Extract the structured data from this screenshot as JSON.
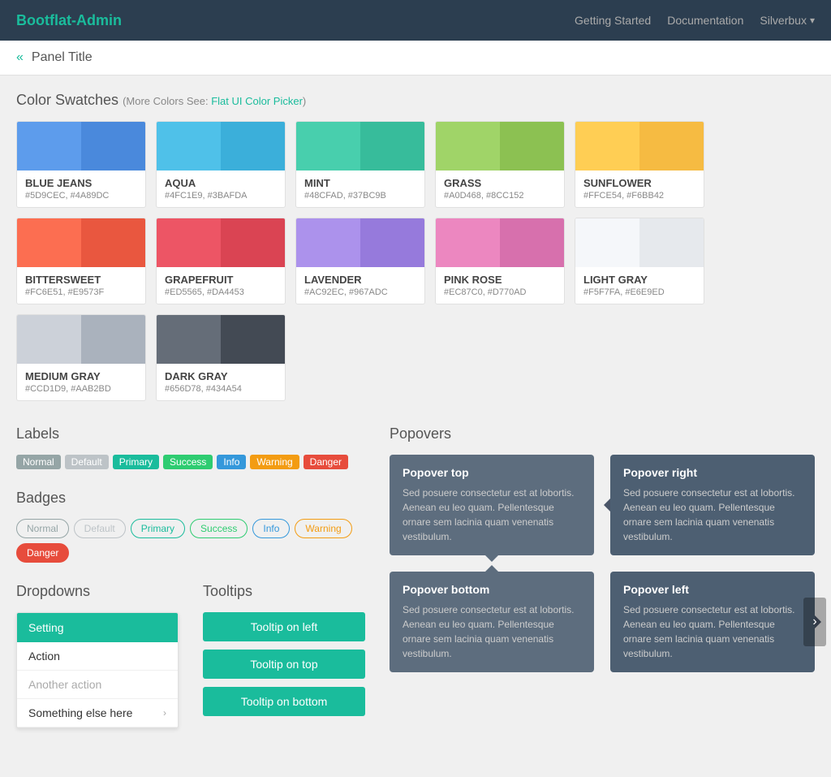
{
  "navbar": {
    "brand": "Bootflat-Admin",
    "links": [
      "Getting Started",
      "Documentation"
    ],
    "dropdown": "Silverbux"
  },
  "panel": {
    "title": "Panel Title"
  },
  "color_swatches": {
    "section_title": "Color Swatches",
    "more_colors_label": "More Colors See",
    "more_colors_link": "Flat UI Color Picker",
    "colors": [
      {
        "name": "BLUE JEANS",
        "hex": "#5D9CEC, #4A89DC",
        "c1": "#5D9CEC",
        "c2": "#4A89DC"
      },
      {
        "name": "AQUA",
        "hex": "#4FC1E9, #3BAFDA",
        "c1": "#4FC1E9",
        "c2": "#3BAFDA"
      },
      {
        "name": "MINT",
        "hex": "#48CFAD, #37BC9B",
        "c1": "#48CFAD",
        "c2": "#37BC9B"
      },
      {
        "name": "GRASS",
        "hex": "#A0D468, #8CC152",
        "c1": "#A0D468",
        "c2": "#8CC152"
      },
      {
        "name": "SUNFLOWER",
        "hex": "#FFCE54, #F6BB42",
        "c1": "#FFCE54",
        "c2": "#F6BB42"
      },
      {
        "name": "BITTERSWEET",
        "hex": "#FC6E51, #E9573F",
        "c1": "#FC6E51",
        "c2": "#E9573F"
      },
      {
        "name": "GRAPEFRUIT",
        "hex": "#ED5565, #DA4453",
        "c1": "#ED5565",
        "c2": "#DA4453"
      },
      {
        "name": "LAVENDER",
        "hex": "#AC92EC, #967ADC",
        "c1": "#AC92EC",
        "c2": "#967ADC"
      },
      {
        "name": "PINK ROSE",
        "hex": "#EC87C0, #D770AD",
        "c1": "#EC87C0",
        "c2": "#D770AD"
      },
      {
        "name": "LIGHT GRAY",
        "hex": "#F5F7FA, #E6E9ED",
        "c1": "#F5F7FA",
        "c2": "#E6E9ED"
      },
      {
        "name": "MEDIUM GRAY",
        "hex": "#CCD1D9, #AAB2BD",
        "c1": "#CCD1D9",
        "c2": "#AAB2BD"
      },
      {
        "name": "DARK GRAY",
        "hex": "#656D78, #434A54",
        "c1": "#656D78",
        "c2": "#434A54"
      }
    ]
  },
  "labels": {
    "section_title": "Labels",
    "items": [
      "Normal",
      "Default",
      "Primary",
      "Success",
      "Info",
      "Warning",
      "Danger"
    ]
  },
  "badges": {
    "section_title": "Badges",
    "items": [
      "Normal",
      "Default",
      "Primary",
      "Success",
      "Info",
      "Warning",
      "Danger"
    ]
  },
  "dropdowns": {
    "section_title": "Dropdowns",
    "header": "Setting",
    "items": [
      {
        "label": "Action",
        "muted": false
      },
      {
        "label": "Another action",
        "muted": true
      },
      {
        "label": "Something else here",
        "has_arrow": true
      }
    ]
  },
  "tooltips": {
    "section_title": "Tooltips",
    "buttons": [
      "Tooltip on left",
      "Tooltip on top",
      "Tooltip on bottom"
    ]
  },
  "popovers": {
    "section_title": "Popovers",
    "items": [
      {
        "title": "Popover top",
        "text": "Sed posuere consectetur est at lobortis. Aenean eu leo quam. Pellentesque ornare sem lacinia quam venenatis vestibulum.",
        "arrow": "bottom"
      },
      {
        "title": "Popover right",
        "text": "Sed posuere consectetur est at lobortis. Aenean eu leo quam. Pellentesque ornare sem lacinia quam venenatis vestibulum.",
        "arrow": "left"
      },
      {
        "title": "Popover bottom",
        "text": "Sed posuere consectetur est at lobortis. Aenean eu leo quam. Pellentesque ornare sem lacinia quam venenatis vestibulum.",
        "arrow": "top"
      },
      {
        "title": "Popover left",
        "text": "Sed posuere consectetur est at lobortis. Aenean eu leo quam. Pellentesque ornare sem lacinia quam venenatis vestibulum.",
        "arrow": "right"
      }
    ]
  }
}
